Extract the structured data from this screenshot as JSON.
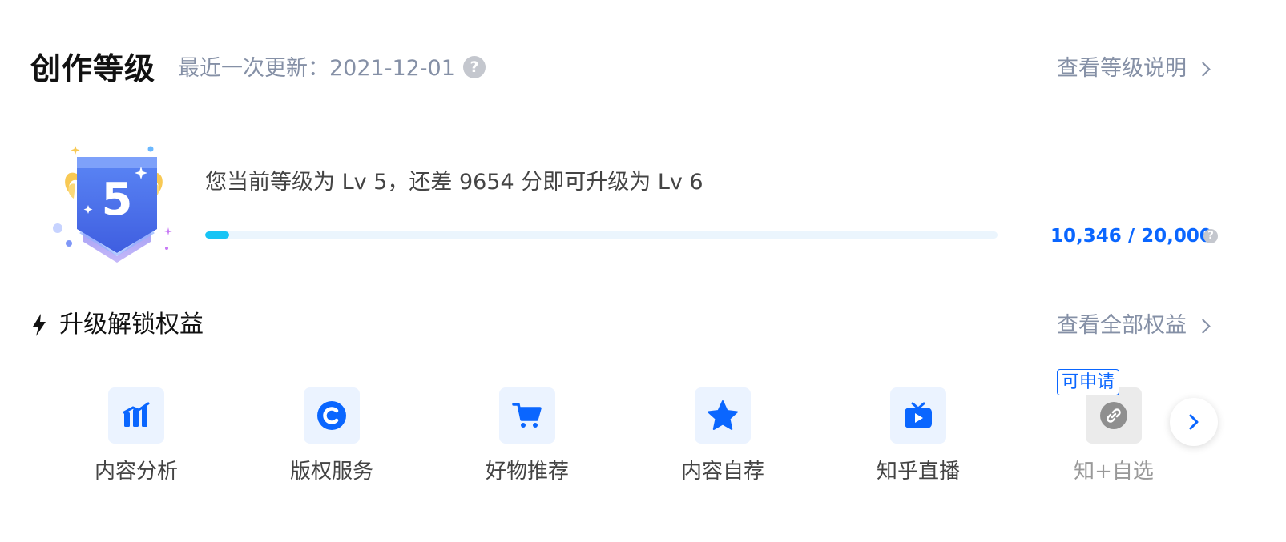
{
  "header": {
    "title": "创作等级",
    "updated": "最近一次更新：2021-12-01",
    "help_icon": "question-icon",
    "level_link": "查看等级说明"
  },
  "level": {
    "badge_number": "5",
    "message": "您当前等级为 Lv 5，还差 9654 分即可升级为 Lv 6",
    "score_text": "10,346 / 20,000",
    "progress": 0.03,
    "accent_color": "#0a66ff",
    "progress_color": "#17c4f5"
  },
  "perks": {
    "title": "升级解锁权益",
    "title_icon": "lightning-icon",
    "view_all": "查看全部权益",
    "apply_tag": "可申请",
    "items": [
      {
        "label": "内容分析",
        "icon": "bar-chart-icon"
      },
      {
        "label": "版权服务",
        "icon": "copyright-icon"
      },
      {
        "label": "好物推荐",
        "icon": "cart-icon"
      },
      {
        "label": "内容自荐",
        "icon": "star-icon"
      },
      {
        "label": "知乎直播",
        "icon": "tv-icon"
      },
      {
        "label": "知+自选",
        "icon": "link-icon"
      }
    ]
  }
}
